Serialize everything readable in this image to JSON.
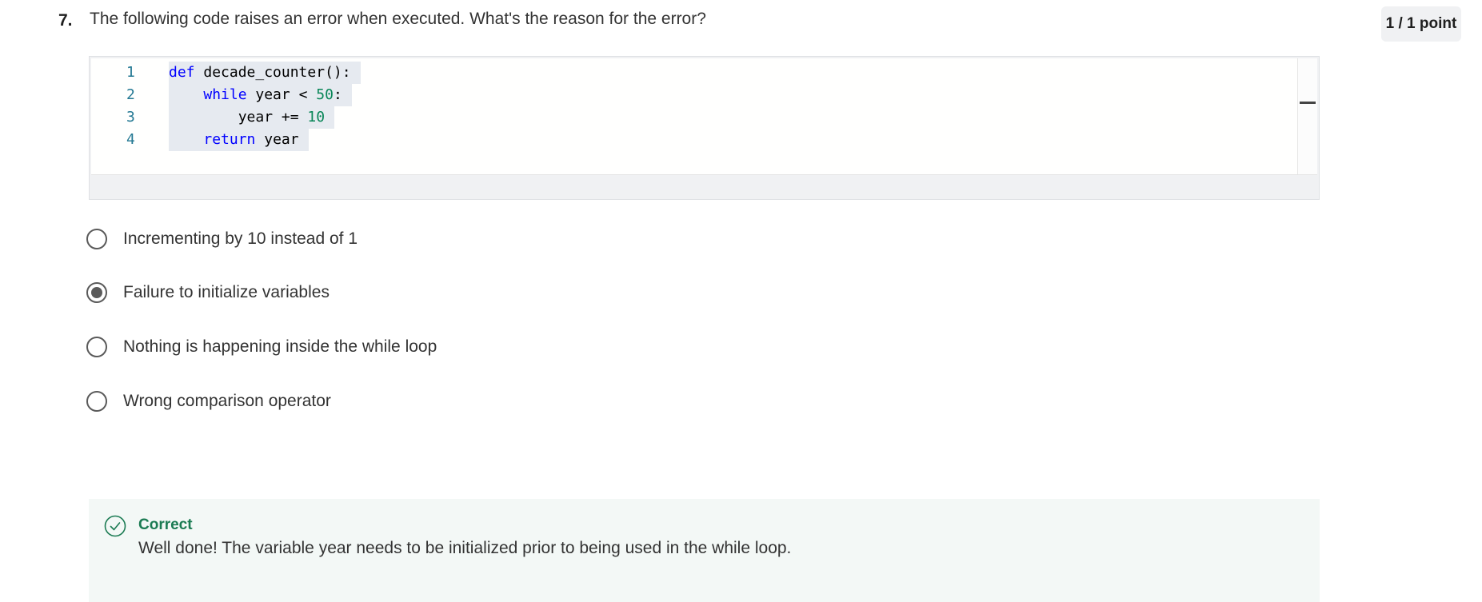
{
  "question": {
    "number": "7.",
    "text": "The following code raises an error when executed. What's the reason for the error?",
    "points": "1 / 1 point"
  },
  "code_editor": {
    "language": "python",
    "lines": [
      {
        "number": "1",
        "tokens": [
          {
            "t": "def",
            "kind": "keyword"
          },
          {
            "t": " decade_counter():",
            "kind": "plain"
          }
        ]
      },
      {
        "number": "2",
        "tokens": [
          {
            "t": "    ",
            "kind": "plain"
          },
          {
            "t": "while",
            "kind": "keyword"
          },
          {
            "t": " year < ",
            "kind": "plain"
          },
          {
            "t": "50",
            "kind": "number"
          },
          {
            "t": ":",
            "kind": "plain"
          }
        ]
      },
      {
        "number": "3",
        "tokens": [
          {
            "t": "        year += ",
            "kind": "plain"
          },
          {
            "t": "10",
            "kind": "number"
          }
        ]
      },
      {
        "number": "4",
        "tokens": [
          {
            "t": "    ",
            "kind": "plain"
          },
          {
            "t": "return",
            "kind": "keyword"
          },
          {
            "t": " year",
            "kind": "plain"
          }
        ]
      }
    ]
  },
  "options": [
    {
      "label": "Incrementing by 10 instead of 1",
      "selected": false
    },
    {
      "label": "Failure to initialize variables",
      "selected": true
    },
    {
      "label": "Nothing is happening inside the while loop",
      "selected": false
    },
    {
      "label": "Wrong comparison operator",
      "selected": false
    }
  ],
  "feedback": {
    "status": "Correct",
    "message": "Well done! The variable year needs to be initialized prior to being used in the while loop.",
    "icon": "check-circle-icon",
    "color": "#1b7b53"
  },
  "colors": {
    "keyword": "#0000ff",
    "number": "#098658",
    "line_number": "#237893",
    "feedback_bg": "#f3f8f6"
  }
}
